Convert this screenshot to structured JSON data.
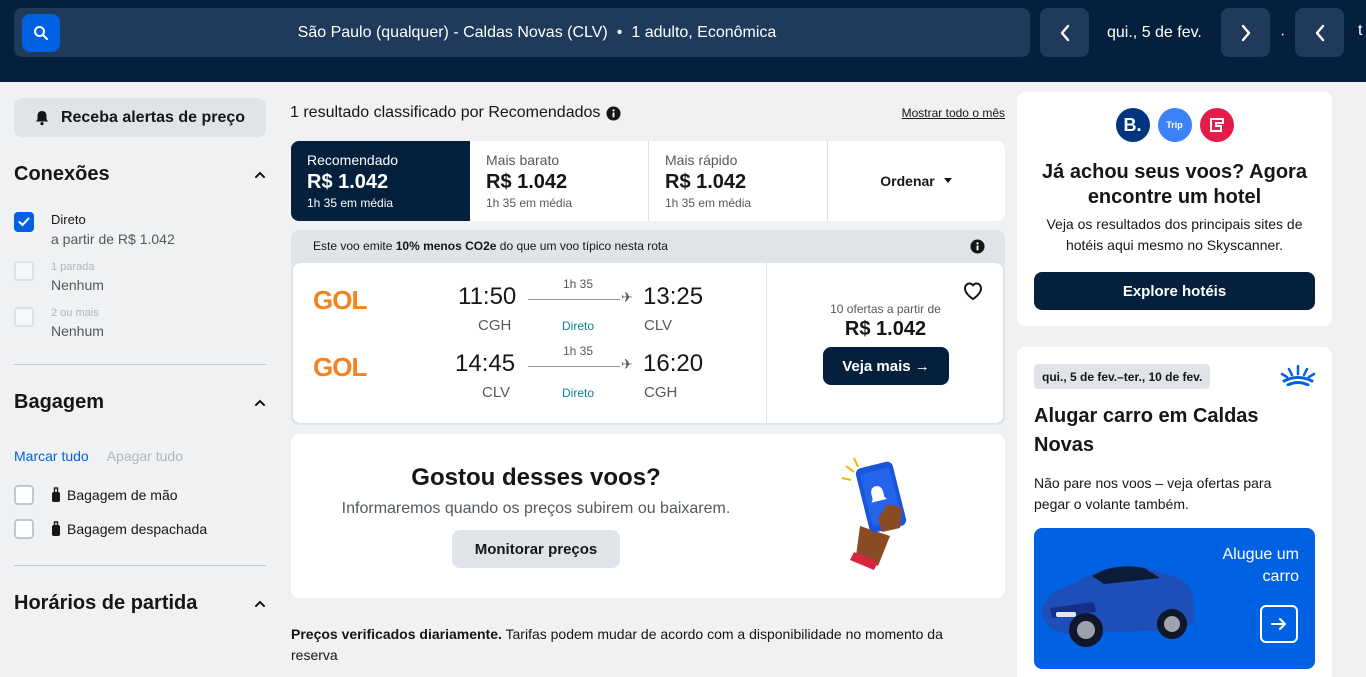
{
  "topbar": {
    "search_summary": "São Paulo (qualquer) - Caldas Novas (CLV)",
    "search_separator": "•",
    "search_passengers": "1 adulto, Econômica",
    "depart_date": "qui., 5 de fev.",
    "date_separator": "·",
    "return_date_truncated": "t"
  },
  "sidebar": {
    "price_alert_label": "Receba alertas de preço",
    "connections": {
      "title": "Conexões",
      "options": [
        {
          "label": "Direto",
          "sub": "a partir de R$ 1.042",
          "checked": true,
          "disabled": false
        },
        {
          "label": "1 parada",
          "sub": "Nenhum",
          "checked": false,
          "disabled": true
        },
        {
          "label": "2 ou mais",
          "sub": "Nenhum",
          "checked": false,
          "disabled": true
        }
      ]
    },
    "baggage": {
      "title": "Bagagem",
      "select_all": "Marcar tudo",
      "clear_all": "Apagar tudo",
      "options": [
        {
          "label": "Bagagem de mão"
        },
        {
          "label": "Bagagem despachada"
        }
      ]
    },
    "departure_times": {
      "title": "Horários de partida"
    }
  },
  "results": {
    "summary": "1 resultado classificado por Recomendados",
    "month_link": "Mostrar todo o mês",
    "sort_tabs": [
      {
        "label": "Recomendado",
        "price": "R$ 1.042",
        "avg": "1h 35 em média",
        "active": true
      },
      {
        "label": "Mais barato",
        "price": "R$ 1.042",
        "avg": "1h 35 em média",
        "active": false
      },
      {
        "label": "Mais rápido",
        "price": "R$ 1.042",
        "avg": "1h 35 em média",
        "active": false
      }
    ],
    "order_label": "Ordenar",
    "co2_prefix": "Este voo emite ",
    "co2_bold": "10% menos CO2e",
    "co2_suffix": " do que um voo típico nesta rota",
    "flight": {
      "legs": [
        {
          "airline": "GOL",
          "dep_time": "11:50",
          "dep_code": "CGH",
          "duration": "1h 35",
          "stops": "Direto",
          "arr_time": "13:25",
          "arr_code": "CLV"
        },
        {
          "airline": "GOL",
          "dep_time": "14:45",
          "dep_code": "CLV",
          "duration": "1h 35",
          "stops": "Direto",
          "arr_time": "16:20",
          "arr_code": "CGH"
        }
      ],
      "offers_text": "10 ofertas a partir de",
      "price": "R$ 1.042",
      "see_more": "Veja mais →"
    },
    "promo": {
      "title": "Gostou desses voos?",
      "subtitle": "Informaremos quando os preços subirem ou baixarem.",
      "button": "Monitorar preços"
    },
    "note_bold": "Preços verificados diariamente.",
    "note_text": " Tarifas podem mudar de acordo com a disponibilidade no momento da reserva"
  },
  "hotel_card": {
    "logos": [
      {
        "text": "B.",
        "color": "#003580"
      },
      {
        "text": "Trip",
        "color": "#3b82f6"
      },
      {
        "text": "",
        "color": "#e11d48"
      }
    ],
    "title": "Já achou seus voos? Agora encontre um hotel",
    "subtitle": "Veja os resultados dos principais sites de hotéis aqui mesmo no Skyscanner.",
    "button": "Explore hotéis"
  },
  "car_card": {
    "dates": "qui., 5 de fev.–ter., 10 de fev.",
    "title": "Alugar carro em Caldas Novas",
    "subtitle": "Não pare nos voos – veja ofertas para pegar o volante também.",
    "banner_text_1": "Alugue um",
    "banner_text_2": "carro"
  },
  "colors": {
    "nav_bg": "#05203c",
    "accent_blue": "#0062e3",
    "gol_orange": "#f58220",
    "direct_teal": "#0c838a"
  }
}
